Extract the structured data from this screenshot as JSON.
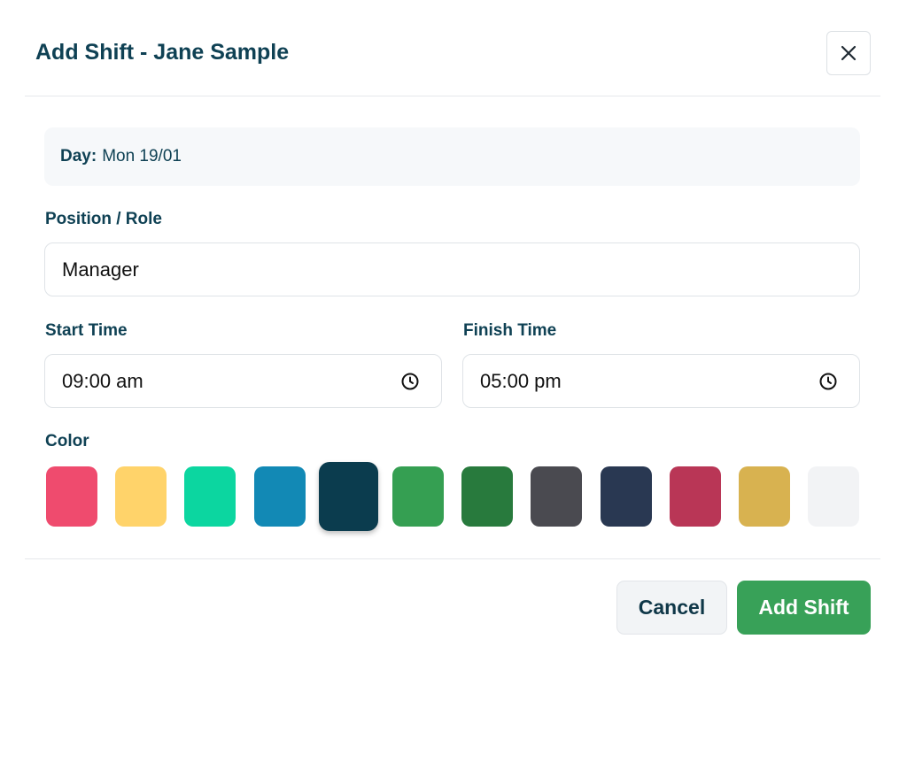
{
  "header": {
    "title": "Add Shift - Jane Sample"
  },
  "day": {
    "label": "Day:",
    "value": "Mon 19/01"
  },
  "position": {
    "label": "Position / Role",
    "value": "Manager"
  },
  "start_time": {
    "label": "Start Time",
    "value": "09:00 am"
  },
  "finish_time": {
    "label": "Finish Time",
    "value": "05:00 pm"
  },
  "color": {
    "label": "Color",
    "selected_index": 4,
    "swatches": [
      "#ef4b6e",
      "#ffd36a",
      "#0cd6a0",
      "#1289b5",
      "#0b3c4e",
      "#359f52",
      "#287a3d",
      "#4a4a50",
      "#293852",
      "#b93656",
      "#d8b250",
      "#f2f3f5"
    ]
  },
  "footer": {
    "cancel_label": "Cancel",
    "add_label": "Add Shift"
  }
}
